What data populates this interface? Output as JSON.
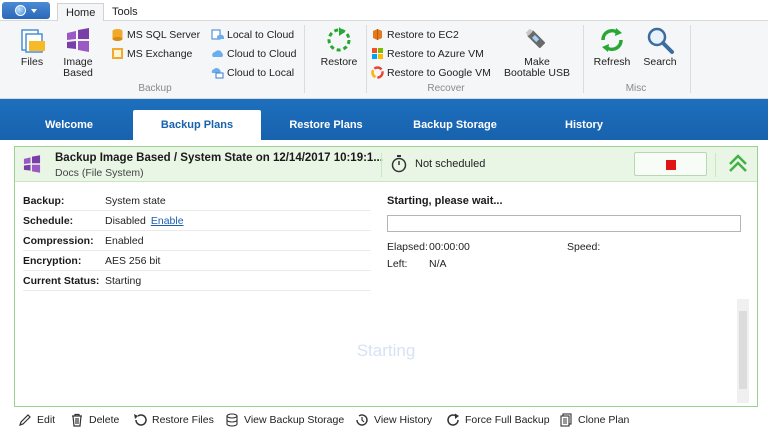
{
  "menubar": {
    "tabs": [
      {
        "label": "Home"
      },
      {
        "label": "Tools"
      }
    ]
  },
  "ribbon": {
    "backup_group": {
      "label": "Backup",
      "files": "Files",
      "image_based": "Image Based",
      "ms_sql": "MS SQL Server",
      "ms_exchange": "MS Exchange",
      "local_to_cloud": "Local to Cloud",
      "cloud_to_cloud": "Cloud to Cloud",
      "cloud_to_local": "Cloud to Local"
    },
    "recover_group": {
      "label": "Recover",
      "restore": "Restore",
      "restore_ec2": "Restore to EC2",
      "restore_azure": "Restore to Azure VM",
      "restore_google": "Restore to Google VM",
      "make_usb": "Make Bootable USB"
    },
    "misc_group": {
      "label": "Misc",
      "refresh": "Refresh",
      "search": "Search"
    }
  },
  "tabs": [
    {
      "label": "Welcome"
    },
    {
      "label": "Backup Plans"
    },
    {
      "label": "Restore Plans"
    },
    {
      "label": "Backup Storage"
    },
    {
      "label": "History"
    }
  ],
  "plan": {
    "title": "Backup Image Based / System State on 12/14/2017 10:19:1...",
    "subtitle": "Docs (File System)",
    "schedule_text": "Not scheduled",
    "properties": [
      {
        "key": "Backup:",
        "value": "System state"
      },
      {
        "key": "Schedule:",
        "value": "Disabled",
        "link": "Enable"
      },
      {
        "key": "Compression:",
        "value": "Enabled"
      },
      {
        "key": "Encryption:",
        "value": "AES 256 bit"
      },
      {
        "key": "Current Status:",
        "value": "Starting"
      }
    ],
    "progress": {
      "status": "Starting, please wait...",
      "percent": 0,
      "elapsed_label": "Elapsed:",
      "elapsed_value": "00:00:00",
      "speed_label": "Speed:",
      "left_label": "Left:",
      "left_value": "N/A"
    },
    "watermark": "Starting"
  },
  "actions": {
    "edit": "Edit",
    "delete": "Delete",
    "restore_files": "Restore Files",
    "view_storage": "View Backup Storage",
    "view_history": "View History",
    "force_full": "Force Full Backup",
    "clone": "Clone Plan"
  },
  "colors": {
    "tabbar": "#1862ad",
    "plan_border": "#9bd28f",
    "plan_header": "#e9f6e6",
    "stop_red": "#e01414",
    "accent_green": "#27a834"
  }
}
